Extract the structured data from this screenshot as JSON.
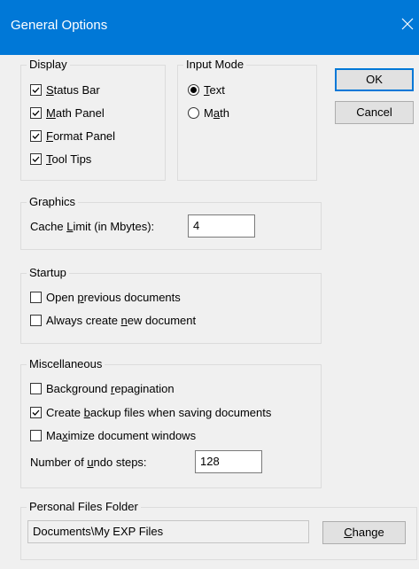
{
  "window": {
    "title": "General Options",
    "accent_color": "#0078d7",
    "close_icon": "close-icon"
  },
  "display": {
    "legend": "Display",
    "status_bar": {
      "label_pre": "",
      "label_u": "S",
      "label_post": "tatus Bar",
      "checked": true
    },
    "math_panel": {
      "label_pre": "",
      "label_u": "M",
      "label_post": "ath Panel",
      "checked": true
    },
    "format_panel": {
      "label_pre": "",
      "label_u": "F",
      "label_post": "ormat Panel",
      "checked": true
    },
    "tool_tips": {
      "label_pre": "",
      "label_u": "T",
      "label_post": "ool Tips",
      "checked": true
    }
  },
  "input_mode": {
    "legend": "Input Mode",
    "text": {
      "label_pre": "",
      "label_u": "T",
      "label_post": "ext",
      "selected": true
    },
    "math": {
      "label_pre": "M",
      "label_u": "a",
      "label_post": "th",
      "selected": false
    }
  },
  "buttons": {
    "ok": "OK",
    "cancel": "Cancel"
  },
  "graphics": {
    "legend": "Graphics",
    "cache_label_pre": "Cache ",
    "cache_label_u": "L",
    "cache_label_post": "imit (in Mbytes):",
    "cache_value": "4"
  },
  "startup": {
    "legend": "Startup",
    "open_previous": {
      "label_pre": "Open ",
      "label_u": "p",
      "label_post": "revious documents",
      "checked": false
    },
    "always_create": {
      "label_pre": "Always create ",
      "label_u": "n",
      "label_post": "ew document",
      "checked": false
    }
  },
  "misc": {
    "legend": "Miscellaneous",
    "background_repag": {
      "label_pre": "Background ",
      "label_u": "r",
      "label_post": "epagination",
      "checked": false
    },
    "create_backup": {
      "label_pre": "Create ",
      "label_u": "b",
      "label_post": "ackup files when saving documents",
      "checked": true
    },
    "maximize": {
      "label_pre": "Ma",
      "label_u": "x",
      "label_post": "imize document windows",
      "checked": false
    },
    "undo_label_pre": "Number of ",
    "undo_label_u": "u",
    "undo_label_post": "ndo steps:",
    "undo_value": "128"
  },
  "personal": {
    "legend": "Personal Files Folder",
    "path": "Documents\\My EXP Files",
    "change_pre": "",
    "change_u": "C",
    "change_post": "hange"
  }
}
